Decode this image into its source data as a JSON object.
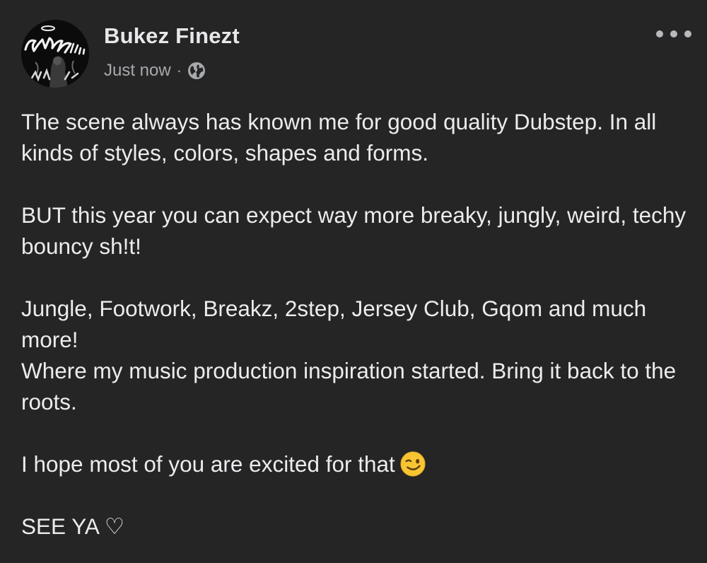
{
  "post": {
    "author": "Bukez Finezt",
    "timestamp": "Just now",
    "separator": "·",
    "privacy_icon": "globe-icon",
    "menu_icon": "more-options-icon",
    "avatar_icon": "profile-avatar",
    "paragraphs": [
      "The scene always has known me for good quality Dubstep. In all kinds of styles, colors, shapes and forms.",
      "BUT this year you can expect way more breaky, jungly, weird, techy bouncy sh!t!",
      "Jungle, Footwork, Breakz, 2step, Jersey Club, Gqom and much more!",
      "Where my music production inspiration started. Bring it back to the roots.",
      "I hope most of you are excited for that",
      "SEE YA ♡"
    ],
    "emoji": "winking-face-emoji"
  },
  "colors": {
    "background": "#252526",
    "text": "#ececee",
    "muted": "#a7a9ad"
  }
}
